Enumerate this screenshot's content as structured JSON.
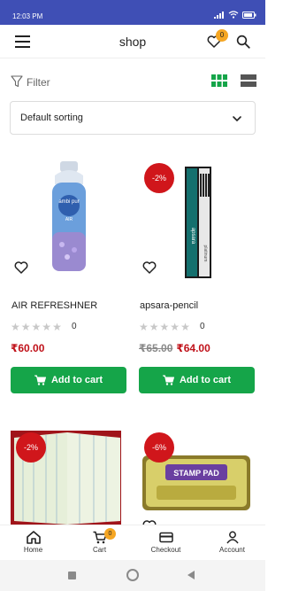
{
  "status": {
    "time": "12:03 PM"
  },
  "header": {
    "title": "shop",
    "wishlist_count": "0"
  },
  "filter": {
    "label": "Filter"
  },
  "sort": {
    "selected": "Default sorting"
  },
  "products": [
    {
      "name": "AIR REFRESHNER",
      "rating_count": "0",
      "old_price": "",
      "price": "₹60.00",
      "sale": "",
      "cart_label": "Add to cart",
      "brand": "ambi pur",
      "sub": "AIR"
    },
    {
      "name": "apsara-pencil",
      "rating_count": "0",
      "old_price": "₹65.00",
      "price": "₹64.00",
      "sale": "-2%",
      "cart_label": "Add to cart",
      "brand": "apsara",
      "sub": "platinum"
    },
    {
      "sale": "-2%"
    },
    {
      "sale": "-6%",
      "brand": "STAMP PAD"
    }
  ],
  "bottom_nav": {
    "home": "Home",
    "cart": "Cart",
    "checkout": "Checkout",
    "account": "Account",
    "cart_count": "0"
  },
  "colors": {
    "accent": "#3f4fb5",
    "sale": "#d0161b",
    "cart_button": "#15a549",
    "price": "#c0121a",
    "badge": "#f5a623"
  }
}
